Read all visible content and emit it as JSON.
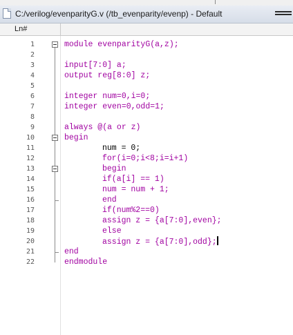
{
  "window": {
    "title": "C:/verilog/evenparityG.v (/tb_evenparity/evenp) - Default"
  },
  "gutter_header": "Ln#",
  "icons": {
    "file": "file-icon",
    "menu": "window-menu-icon",
    "fold": "fold-collapse-icon"
  },
  "colors": {
    "keyword": "#a000a0",
    "text": "#000000",
    "line_number": "#555555"
  },
  "lines": [
    {
      "n": "1",
      "indent": 0,
      "segs": [
        [
          "kw",
          "module evenparityG(a,z);"
        ]
      ]
    },
    {
      "n": "2",
      "indent": 0,
      "segs": []
    },
    {
      "n": "3",
      "indent": 0,
      "segs": [
        [
          "kw",
          "input[7:0] a;"
        ]
      ]
    },
    {
      "n": "4",
      "indent": 0,
      "segs": [
        [
          "kw",
          "output reg[8:0] z;"
        ]
      ]
    },
    {
      "n": "5",
      "indent": 0,
      "segs": []
    },
    {
      "n": "6",
      "indent": 0,
      "segs": [
        [
          "kw",
          "integer num=0,i=0;"
        ]
      ]
    },
    {
      "n": "7",
      "indent": 0,
      "segs": [
        [
          "kw",
          "integer even=0,odd=1;"
        ]
      ]
    },
    {
      "n": "8",
      "indent": 0,
      "segs": []
    },
    {
      "n": "9",
      "indent": 0,
      "segs": [
        [
          "kw",
          "always @(a or z)"
        ]
      ]
    },
    {
      "n": "10",
      "indent": 0,
      "segs": [
        [
          "kw",
          "begin"
        ]
      ]
    },
    {
      "n": "11",
      "indent": 1,
      "segs": [
        [
          "tx",
          "num = 0;"
        ]
      ]
    },
    {
      "n": "12",
      "indent": 1,
      "segs": [
        [
          "kw",
          "for(i=0;i<8;i=i+1)"
        ]
      ]
    },
    {
      "n": "13",
      "indent": 1,
      "segs": [
        [
          "kw",
          "begin"
        ]
      ]
    },
    {
      "n": "14",
      "indent": 1,
      "segs": [
        [
          "kw",
          "if(a[i] == 1)"
        ]
      ]
    },
    {
      "n": "15",
      "indent": 1,
      "segs": [
        [
          "kw",
          "num = num + 1;"
        ]
      ]
    },
    {
      "n": "16",
      "indent": 1,
      "segs": [
        [
          "kw",
          "end"
        ]
      ]
    },
    {
      "n": "17",
      "indent": 1,
      "segs": [
        [
          "kw",
          "if(num%2==0)"
        ]
      ]
    },
    {
      "n": "18",
      "indent": 1,
      "segs": [
        [
          "kw",
          "assign z = {a[7:0],even};"
        ]
      ]
    },
    {
      "n": "19",
      "indent": 1,
      "segs": [
        [
          "kw",
          "else"
        ]
      ]
    },
    {
      "n": "20",
      "indent": 1,
      "segs": [
        [
          "kw",
          "assign z = {a[7:0],odd};"
        ]
      ],
      "caret": true
    },
    {
      "n": "21",
      "indent": 0,
      "segs": [
        [
          "kw",
          "end"
        ]
      ]
    },
    {
      "n": "22",
      "indent": 0,
      "segs": [
        [
          "kw",
          "endmodule"
        ]
      ]
    }
  ]
}
